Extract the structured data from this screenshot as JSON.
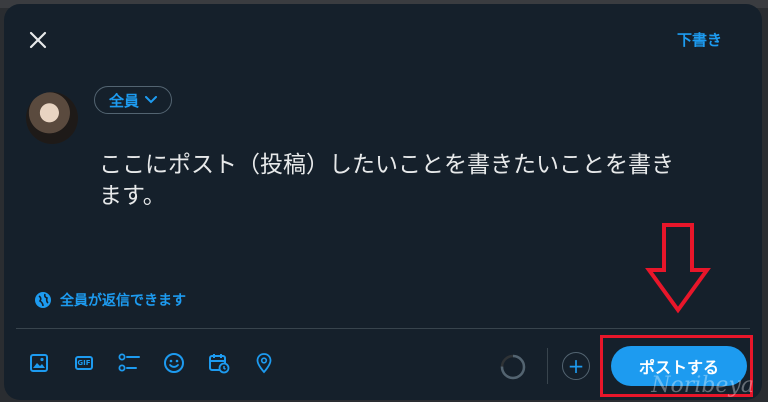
{
  "header": {
    "close_icon": "close-icon",
    "drafts_label": "下書き"
  },
  "composer": {
    "audience_label": "全員",
    "text_line1": "ここにポスト（投稿）したいことを書きたいことを書き",
    "text_line2": "ます。",
    "reply_setting_label": "全員が返信できます",
    "reply_setting_icon": "globe-icon"
  },
  "toolbar": {
    "icons": [
      "image-icon",
      "gif-icon",
      "poll-icon",
      "emoji-icon",
      "schedule-icon",
      "location-icon"
    ],
    "gif_label": "GIF",
    "add_label": "+",
    "post_label": "ポストする"
  },
  "annotation": {
    "watermark": "Noribeya",
    "highlight_color": "#e8162a",
    "arrow": "down-arrow"
  },
  "colors": {
    "accent": "#1d9bf0",
    "background": "#15202b",
    "text": "#e7e9ea"
  }
}
